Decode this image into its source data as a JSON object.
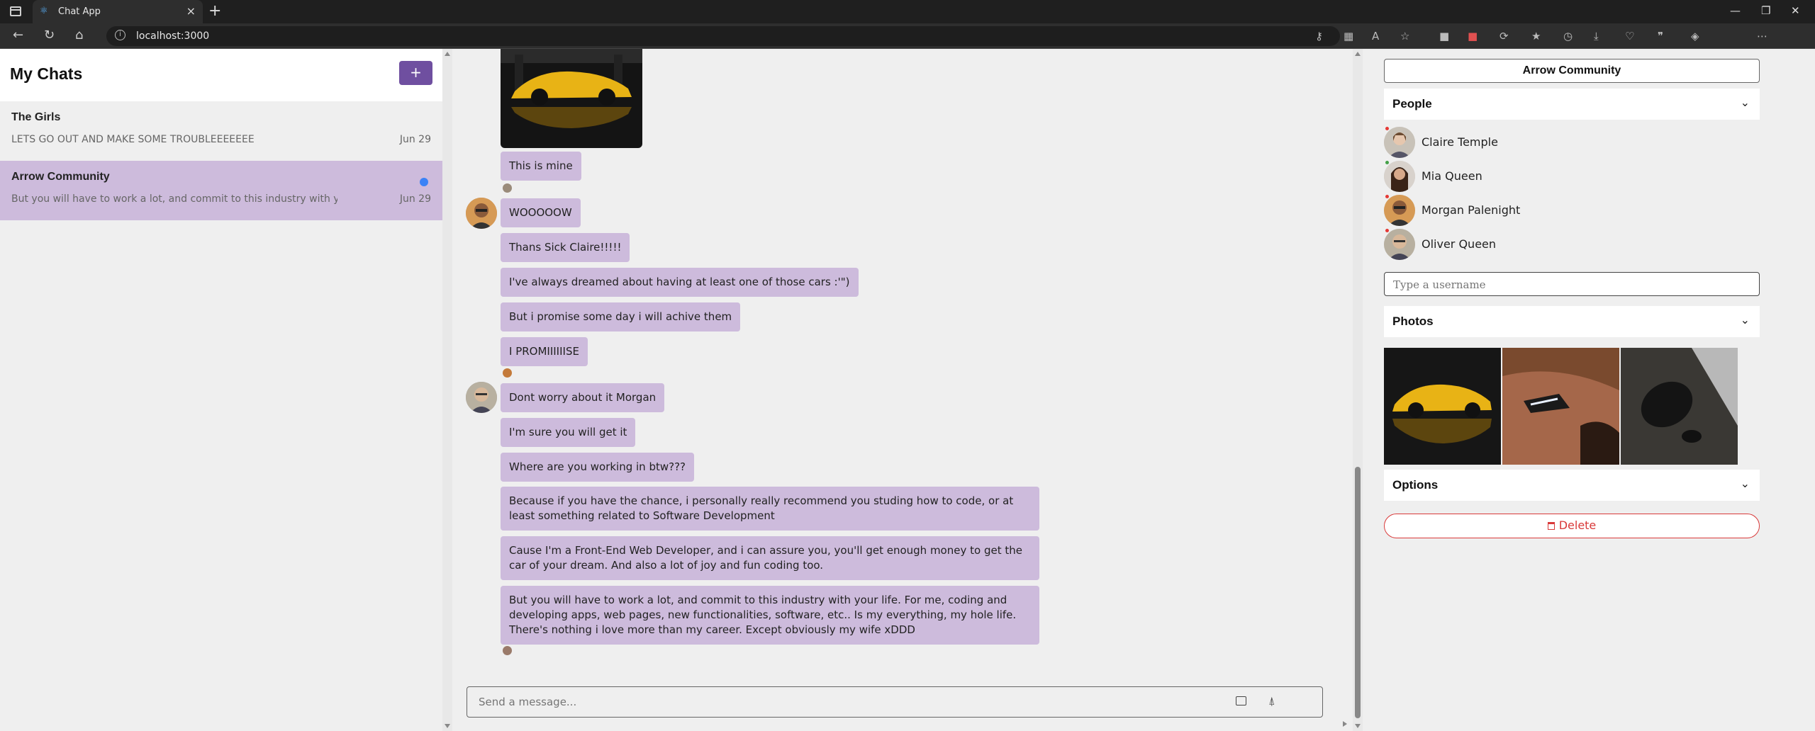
{
  "browser": {
    "tab_title": "Chat App",
    "url": "localhost:3000"
  },
  "sidebar": {
    "title": "My Chats",
    "add_button": "+",
    "chats": [
      {
        "name": "The Girls",
        "preview": "LETS GO OUT AND MAKE SOME TROUBLEEEEEEE",
        "date": "Jun 29",
        "active": false,
        "unread": false
      },
      {
        "name": "Arrow Community",
        "preview": "But you will have to work a lot, and commit to this industry with y",
        "date": "Jun 29",
        "active": true,
        "unread": true
      }
    ]
  },
  "chat": {
    "messages": [
      {
        "text": "This is mine"
      },
      {
        "text": "WOOOOOW"
      },
      {
        "text": "Thans Sick Claire!!!!!"
      },
      {
        "text": "I've always dreamed about having at least one of those cars :'\")"
      },
      {
        "text": "But i promise some day i will achive them"
      },
      {
        "text": "I PROMIIIIIISE"
      },
      {
        "text": "Dont worry about it Morgan"
      },
      {
        "text": "I'm sure you will get it"
      },
      {
        "text": "Where are you working in btw???"
      },
      {
        "text": "Because if you have the chance, i personally really recommend you studing how to code, or at least something related to Software Development"
      },
      {
        "text": "Cause I'm a Front-End Web Developer, and i can assure you, you'll get enough money to get the car of your dream. And also a lot of joy and fun coding too."
      },
      {
        "text": "But you will have to work a lot, and commit to this industry with your life. For me, coding and developing apps, web pages, new functionalities, software, etc.. Is my everything, my hole life. There's nothing i love more than my career. Except obviously my wife xDDD"
      }
    ],
    "composer_placeholder": "Send a message..."
  },
  "details": {
    "room_name": "Arrow Community",
    "people_label": "People",
    "people": [
      {
        "name": "Claire Temple"
      },
      {
        "name": "Mia Queen"
      },
      {
        "name": "Morgan Palenight"
      },
      {
        "name": "Oliver Queen"
      }
    ],
    "username_placeholder": "Type a username",
    "photos_label": "Photos",
    "options_label": "Options",
    "delete_label": "Delete"
  },
  "colors": {
    "accent": "#6f4fa0",
    "bubble": "#cdbbdc",
    "active_chat": "#cdbbdc",
    "unread_dot": "#3b82f6",
    "danger": "#d93a3a"
  }
}
